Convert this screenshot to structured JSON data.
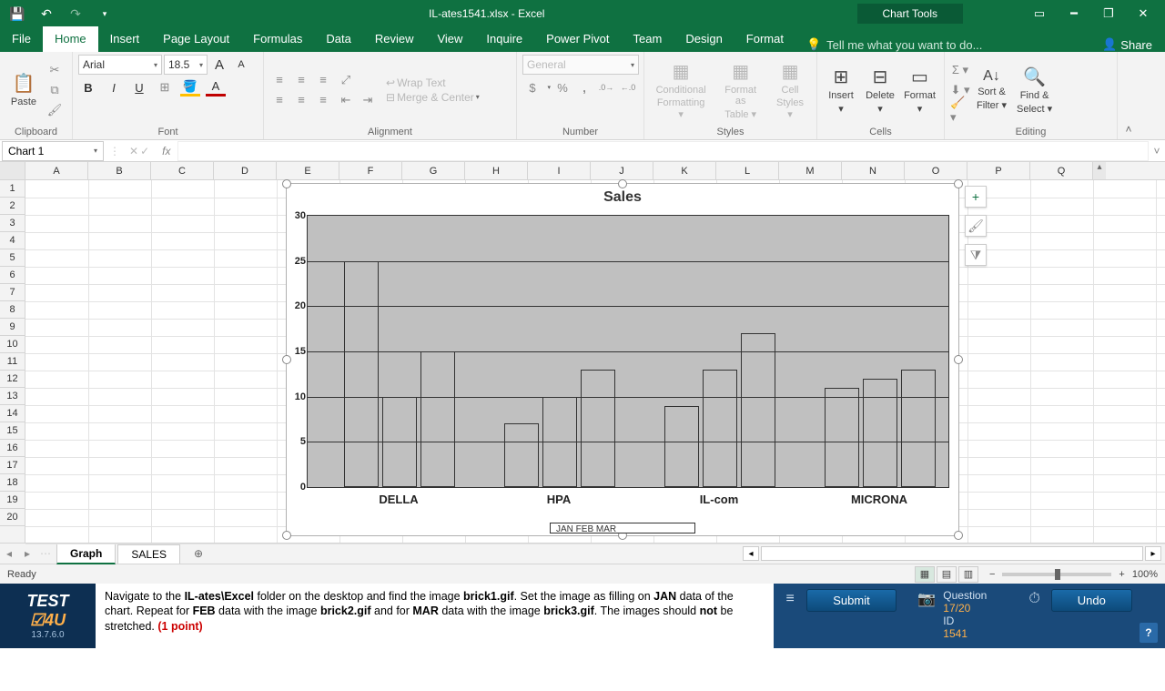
{
  "titlebar": {
    "title": "IL-ates1541.xlsx - Excel",
    "chart_tools": "Chart Tools"
  },
  "tabs": {
    "file": "File",
    "home": "Home",
    "insert": "Insert",
    "pagelayout": "Page Layout",
    "formulas": "Formulas",
    "data": "Data",
    "review": "Review",
    "view": "View",
    "inquire": "Inquire",
    "powerpivot": "Power Pivot",
    "team": "Team",
    "design": "Design",
    "format": "Format",
    "tellme": "Tell me what you want to do...",
    "share": "Share"
  },
  "ribbon": {
    "clipboard": {
      "label": "Clipboard",
      "paste": "Paste"
    },
    "font": {
      "label": "Font",
      "name": "Arial",
      "size": "18.5",
      "bold": "B",
      "italic": "I",
      "underline": "U"
    },
    "alignment": {
      "label": "Alignment",
      "wrap": "Wrap Text",
      "merge": "Merge & Center"
    },
    "number": {
      "label": "Number",
      "format": "General",
      "currency": "$",
      "percent": "%",
      "comma": ","
    },
    "styles": {
      "label": "Styles",
      "cond1": "Conditional",
      "cond2": "Formatting",
      "fat1": "Format as",
      "fat2": "Table",
      "cell1": "Cell",
      "cell2": "Styles"
    },
    "cells": {
      "label": "Cells",
      "insert": "Insert",
      "delete": "Delete",
      "format": "Format"
    },
    "editing": {
      "label": "Editing",
      "sort1": "Sort &",
      "sort2": "Filter",
      "find1": "Find &",
      "find2": "Select"
    }
  },
  "namebox": "Chart 1",
  "columns": [
    "A",
    "B",
    "C",
    "D",
    "E",
    "F",
    "G",
    "H",
    "I",
    "J",
    "K",
    "L",
    "M",
    "N",
    "O",
    "P",
    "Q"
  ],
  "rows": [
    "1",
    "2",
    "3",
    "4",
    "5",
    "6",
    "7",
    "8",
    "9",
    "10",
    "11",
    "12",
    "13",
    "14",
    "15",
    "16",
    "17",
    "18",
    "19",
    "20"
  ],
  "chart_data": {
    "type": "bar",
    "title": "Sales",
    "ylim": [
      0,
      30
    ],
    "yticks": [
      0,
      5,
      10,
      15,
      20,
      25,
      30
    ],
    "categories": [
      "DELLA",
      "HPA",
      "IL-com",
      "MICRONA"
    ],
    "series": [
      {
        "name": "JAN",
        "values": [
          25,
          7,
          9,
          11
        ]
      },
      {
        "name": "FEB",
        "values": [
          10,
          10,
          13,
          12
        ]
      },
      {
        "name": "MAR",
        "values": [
          15,
          13,
          17,
          13
        ]
      }
    ],
    "legend_truncated": "JAN   FEB   MAR"
  },
  "chart_side": {
    "plus": "+",
    "brush": "🖌",
    "filter": "⧩"
  },
  "sheet_tabs": {
    "graph": "Graph",
    "sales": "SALES",
    "add": "⊕"
  },
  "status": {
    "ready": "Ready",
    "zoom": "100%"
  },
  "test4u": {
    "brand": "TEST",
    "brand2": "4U",
    "version": "13.7.6.0",
    "instr_p1": "Navigate to the ",
    "instr_b1": "IL-ates\\Excel",
    "instr_p2": " folder on the desktop and find the image ",
    "instr_b2": "brick1.gif",
    "instr_p3": ". Set the image as filling on ",
    "instr_b3": "JAN",
    "instr_p4": " data of the chart. Repeat for ",
    "instr_b4": "FEB",
    "instr_p5": " data with the image ",
    "instr_b5": "brick2.gif",
    "instr_p6": " and for ",
    "instr_b6": "MAR",
    "instr_p7": " data with the image ",
    "instr_b7": "brick3.gif",
    "instr_p8": ". The images should ",
    "instr_b8": "not",
    "instr_p9": " be stretched. ",
    "instr_pts": "(1 point)",
    "submit": "Submit",
    "undo": "Undo",
    "q_lbl": "Question",
    "q_val": "17/20",
    "id_lbl": "ID",
    "id_val": "1541"
  }
}
